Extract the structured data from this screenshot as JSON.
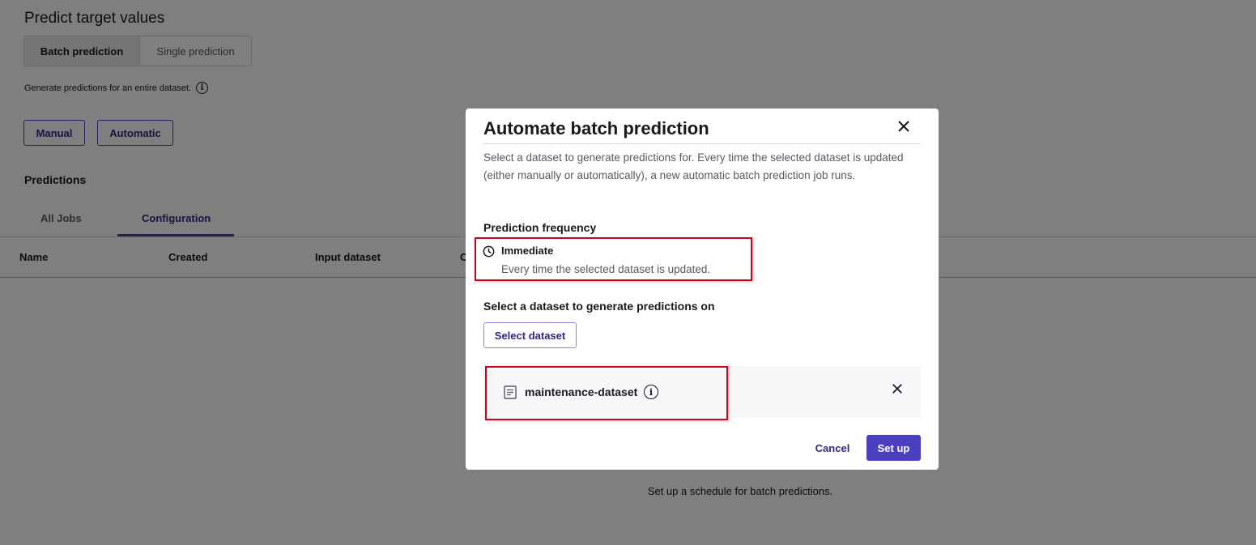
{
  "page": {
    "title": "Predict target values",
    "segments": [
      "Batch prediction",
      "Single prediction"
    ],
    "description": "Generate predictions for an entire dataset.",
    "modes": [
      "Manual",
      "Automatic"
    ],
    "predictions_label": "Predictions",
    "tabs": [
      "All Jobs",
      "Configuration"
    ],
    "columns": [
      "Name",
      "Created",
      "Input dataset",
      "C"
    ],
    "empty_message": "Set up a schedule for batch predictions."
  },
  "modal": {
    "title": "Automate batch prediction",
    "description": "Select a dataset to generate predictions for. Every time the selected dataset is updated (either manually or automatically), a new automatic batch prediction job runs.",
    "frequency_heading": "Prediction frequency",
    "frequency_title": "Immediate",
    "frequency_desc": "Every time the selected dataset is updated.",
    "dataset_heading": "Select a dataset to generate predictions on",
    "select_dataset_label": "Select dataset",
    "selected_dataset": "maintenance-dataset",
    "cancel_label": "Cancel",
    "setup_label": "Set up"
  },
  "colors": {
    "accent": "#4b3fbf",
    "highlight_border": "#d0021b",
    "overlay": "rgba(0,0,0,0.5)"
  },
  "icons": [
    "info-icon",
    "close-icon",
    "clock-icon",
    "document-icon"
  ]
}
